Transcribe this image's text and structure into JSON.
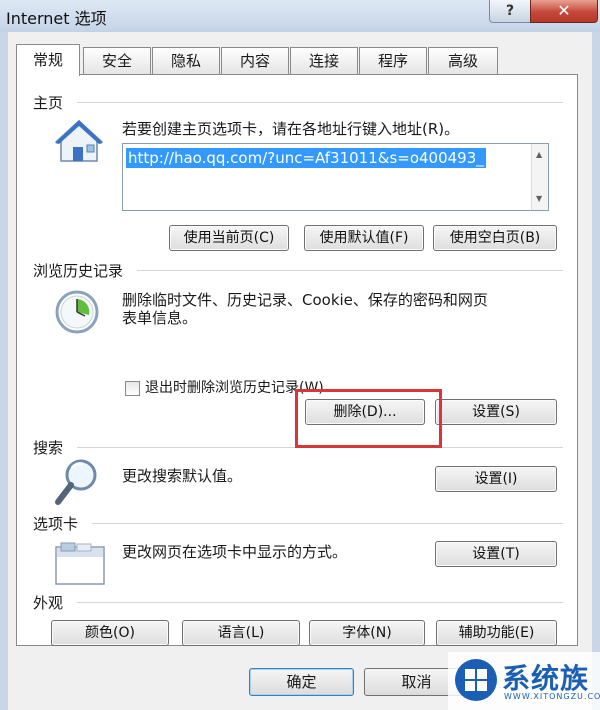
{
  "window": {
    "title": "Internet 选项",
    "help_glyph": "?",
    "close_glyph": "✕"
  },
  "tabs": [
    {
      "label": "常规",
      "active": true
    },
    {
      "label": "安全"
    },
    {
      "label": "隐私"
    },
    {
      "label": "内容"
    },
    {
      "label": "连接"
    },
    {
      "label": "程序"
    },
    {
      "label": "高级"
    }
  ],
  "home": {
    "section_title": "主页",
    "description": "若要创建主页选项卡，请在各地址行键入地址(R)。",
    "url": "http://hao.qq.com/?unc=Af31011&s=o400493_",
    "buttons": {
      "use_current": "使用当前页(C)",
      "use_default": "使用默认值(F)",
      "use_blank": "使用空白页(B)"
    }
  },
  "history": {
    "section_title": "浏览历史记录",
    "description_line1": "删除临时文件、历史记录、Cookie、保存的密码和网页",
    "description_line2": "表单信息。",
    "checkbox_label": "退出时删除浏览历史记录(W)",
    "delete_button": "删除(D)...",
    "settings_button": "设置(S)"
  },
  "search": {
    "section_title": "搜索",
    "description": "更改搜索默认值。",
    "settings_button": "设置(I)"
  },
  "tabs_section": {
    "section_title": "选项卡",
    "description": "更改网页在选项卡中显示的方式。",
    "settings_button": "设置(T)"
  },
  "appearance": {
    "section_title": "外观",
    "buttons": {
      "colors": "颜色(O)",
      "languages": "语言(L)",
      "fonts": "字体(N)",
      "accessibility": "辅助功能(E)"
    }
  },
  "footer": {
    "ok": "确定",
    "cancel": "取消"
  },
  "watermark": {
    "text": "系统族",
    "subtext": "WWW.XITONGZU.COM"
  },
  "colors": {
    "highlight_box": "#d9363a",
    "selection": "#3399ff"
  }
}
